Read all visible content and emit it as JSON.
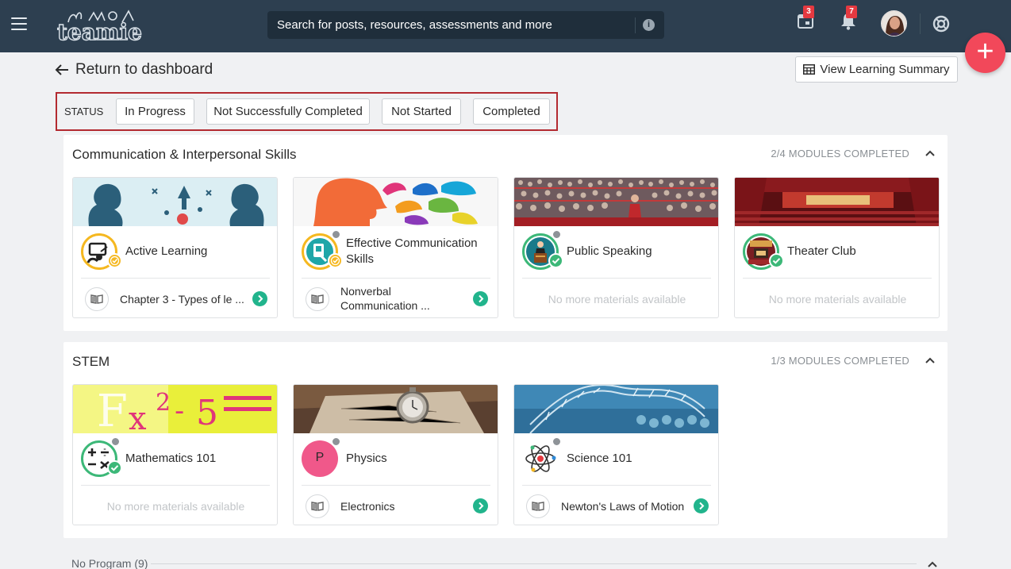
{
  "topbar": {
    "logo_text": "teamie",
    "search_placeholder": "Search for posts, resources, assessments and more",
    "calendar_badge": "3",
    "notifications_badge": "7"
  },
  "header": {
    "back_label": "Return to dashboard",
    "summary_label": "View Learning Summary"
  },
  "status": {
    "label": "STATUS",
    "filters": [
      "In Progress",
      "Not Successfully Completed",
      "Not Started",
      "Completed"
    ]
  },
  "programs": [
    {
      "title": "Communication & Interpersonal Skills",
      "progress": "2/4 MODULES COMPLETED",
      "cards": [
        {
          "name": "Active Learning",
          "material": "Chapter 3 - Types of le ...",
          "status": "in-progress"
        },
        {
          "name": "Effective Communication Skills",
          "material": "Nonverbal Communication ...",
          "status": "in-progress"
        },
        {
          "name": "Public Speaking",
          "material": "No more materials available",
          "status": "completed"
        },
        {
          "name": "Theater Club",
          "material": "No more materials available",
          "status": "completed"
        }
      ]
    },
    {
      "title": "STEM",
      "progress": "1/3 MODULES COMPLETED",
      "cards": [
        {
          "name": "Mathematics 101",
          "material": "No more materials available",
          "status": "completed"
        },
        {
          "name": "Physics",
          "initial": "P",
          "material": "Electronics",
          "status": "none"
        },
        {
          "name": "Science 101",
          "material": "Newton's Laws of Motion",
          "status": "none"
        }
      ]
    }
  ],
  "no_program": "No Program (9)",
  "colors": {
    "topbar": "#2d3f50",
    "fab": "#f2485a",
    "filter_border": "#b32a30",
    "go_button": "#21b48c",
    "completed": "#3cb878",
    "in_progress": "#f5b820"
  }
}
